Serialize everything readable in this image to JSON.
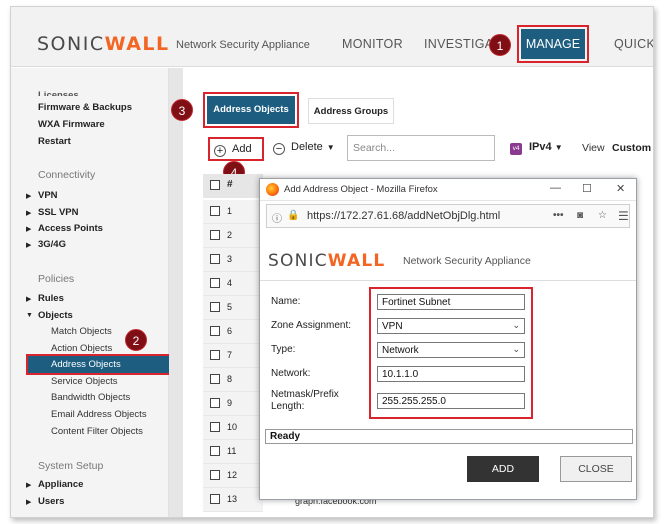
{
  "header": {
    "logo_left": "SONIC",
    "logo_right": "WALL",
    "subtitle": "Network Security Appliance",
    "nav": [
      "MONITOR",
      "INVESTIGA",
      "MANAGE",
      "QUICK"
    ]
  },
  "steps": [
    "1",
    "2",
    "3",
    "4"
  ],
  "sidebar": {
    "cut_top": "Licenses",
    "top_items": [
      "Firmware & Backups",
      "WXA Firmware",
      "Restart"
    ],
    "connectivity": {
      "heading": "Connectivity",
      "items": [
        "VPN",
        "SSL VPN",
        "Access Points",
        "3G/4G"
      ]
    },
    "policies": {
      "heading": "Policies",
      "items": [
        "Rules",
        "Objects"
      ]
    },
    "objects": [
      "Match Objects",
      "Action Objects",
      "Address Objects",
      "Service Objects",
      "Bandwidth Objects",
      "Email Address Objects",
      "Content Filter Objects"
    ],
    "system_setup": {
      "heading": "System Setup",
      "items": [
        "Appliance",
        "Users"
      ]
    }
  },
  "tabs": {
    "address_objects": "Address Objects",
    "address_groups": "Address Groups"
  },
  "toolbar": {
    "add": "Add",
    "delete": "Delete",
    "search_placeholder": "Search...",
    "v4_badge": "v4",
    "ipv4": "IPv4",
    "view": "View",
    "custom": "Custom"
  },
  "table": {
    "header": "#",
    "rows": [
      "1",
      "2",
      "3",
      "4",
      "5",
      "6",
      "7",
      "8",
      "9",
      "10",
      "11",
      "12",
      "13"
    ],
    "peek_text": "graph.facebook.com"
  },
  "dialog": {
    "window_title": "Add Address Object - Mozilla Firefox",
    "url": "https://172.27.61.68/addNetObjDlg.html",
    "logo_left": "SONIC",
    "logo_right": "WALL",
    "subtitle": "Network Security Appliance",
    "fields": {
      "name": {
        "label": "Name:",
        "value": "Fortinet Subnet"
      },
      "zone": {
        "label": "Zone Assignment:",
        "value": "VPN"
      },
      "type": {
        "label": "Type:",
        "value": "Network"
      },
      "network": {
        "label": "Network:",
        "value": "10.1.1.0"
      },
      "netmask": {
        "label": "Netmask/Prefix Length:",
        "value": "255.255.255.0"
      }
    },
    "status": "Ready",
    "add_button": "ADD",
    "close_button": "CLOSE"
  }
}
